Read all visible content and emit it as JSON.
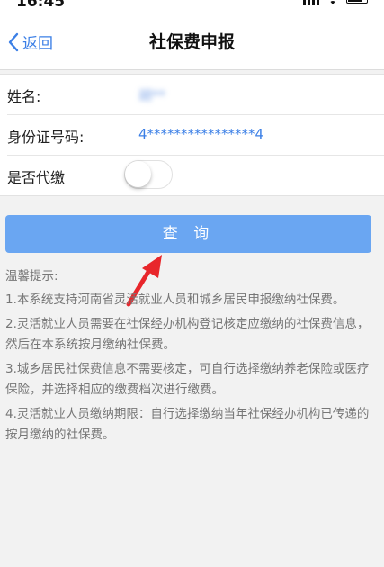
{
  "status_bar": {
    "time": "16:45",
    "icons": [
      "signal-icon",
      "wifi-icon",
      "battery-icon"
    ]
  },
  "nav": {
    "back_label": "返回",
    "title": "社保费申报"
  },
  "form": {
    "name_label": "姓名:",
    "name_value": "胡**",
    "id_label": "身份证号码:",
    "id_value": "4****************4",
    "proxy_label": "是否代缴",
    "proxy_enabled": false
  },
  "query_button_label": "查 询",
  "tips": {
    "title": "温馨提示:",
    "items": [
      "1.本系统支持河南省灵活就业人员和城乡居民申报缴纳社保费。",
      "2.灵活就业人员需要在社保经办机构登记核定应缴纳的社保费信息，然后在本系统按月缴纳社保费。",
      "3.城乡居民社保费信息不需要核定，可自行选择缴纳养老保险或医疗保险，并选择相应的缴费档次进行缴费。",
      "4.灵活就业人员缴纳期限：自行选择缴纳当年社保经办机构已传递的按月缴纳的社保费。"
    ]
  },
  "colors": {
    "accent": "#3b7fe6",
    "button": "#6aa6f2",
    "annotation": "#e8262b",
    "background": "#f2f2f2"
  }
}
